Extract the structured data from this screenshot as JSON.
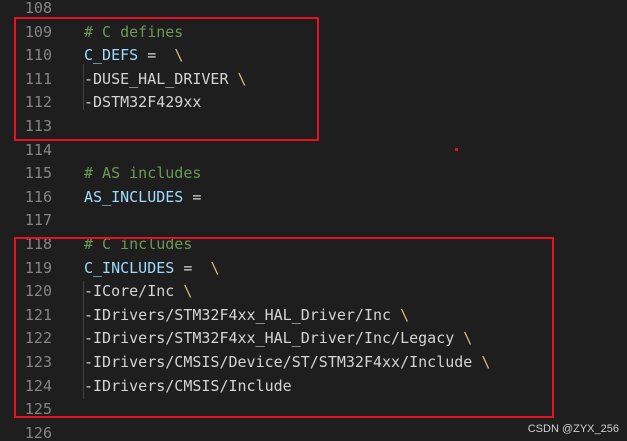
{
  "editor": {
    "lines": [
      {
        "number": "108",
        "tokens": []
      },
      {
        "number": "109",
        "tokens": [
          {
            "type": "comment",
            "text": "# C defines"
          }
        ]
      },
      {
        "number": "110",
        "tokens": [
          {
            "type": "var",
            "text": "C_DEFS"
          },
          {
            "type": "op",
            "text": " =  "
          },
          {
            "type": "cont",
            "text": "\\"
          }
        ]
      },
      {
        "number": "111",
        "tokens": [
          {
            "type": "text",
            "text": "-DUSE_HAL_DRIVER "
          },
          {
            "type": "cont",
            "text": "\\"
          }
        ]
      },
      {
        "number": "112",
        "tokens": [
          {
            "type": "text",
            "text": "-DSTM32F429xx"
          }
        ]
      },
      {
        "number": "113",
        "tokens": []
      },
      {
        "number": "114",
        "tokens": []
      },
      {
        "number": "115",
        "tokens": [
          {
            "type": "comment",
            "text": "# AS includes"
          }
        ]
      },
      {
        "number": "116",
        "tokens": [
          {
            "type": "var",
            "text": "AS_INCLUDES"
          },
          {
            "type": "op",
            "text": " ="
          }
        ]
      },
      {
        "number": "117",
        "tokens": []
      },
      {
        "number": "118",
        "tokens": [
          {
            "type": "comment",
            "text": "# C includes"
          }
        ]
      },
      {
        "number": "119",
        "tokens": [
          {
            "type": "var",
            "text": "C_INCLUDES"
          },
          {
            "type": "op",
            "text": " =  "
          },
          {
            "type": "cont",
            "text": "\\"
          }
        ]
      },
      {
        "number": "120",
        "tokens": [
          {
            "type": "text",
            "text": "-ICore/Inc "
          },
          {
            "type": "cont",
            "text": "\\"
          }
        ]
      },
      {
        "number": "121",
        "tokens": [
          {
            "type": "text",
            "text": "-IDrivers/STM32F4xx_HAL_Driver/Inc "
          },
          {
            "type": "cont",
            "text": "\\"
          }
        ]
      },
      {
        "number": "122",
        "tokens": [
          {
            "type": "text",
            "text": "-IDrivers/STM32F4xx_HAL_Driver/Inc/Legacy "
          },
          {
            "type": "cont",
            "text": "\\"
          }
        ]
      },
      {
        "number": "123",
        "tokens": [
          {
            "type": "text",
            "text": "-IDrivers/CMSIS/Device/ST/STM32F4xx/Include "
          },
          {
            "type": "cont",
            "text": "\\"
          }
        ]
      },
      {
        "number": "124",
        "tokens": [
          {
            "type": "text",
            "text": "-IDrivers/CMSIS/Include"
          }
        ]
      },
      {
        "number": "125",
        "tokens": []
      },
      {
        "number": "126",
        "tokens": []
      }
    ]
  },
  "watermark": "CSDN @ZYX_256",
  "colors": {
    "background": "#1e1e1e",
    "line_number": "#858585",
    "comment": "#6a9955",
    "variable": "#9cdcfe",
    "text": "#d4d4d4",
    "continuation": "#d7ba7d",
    "highlight_box": "#e81123"
  }
}
